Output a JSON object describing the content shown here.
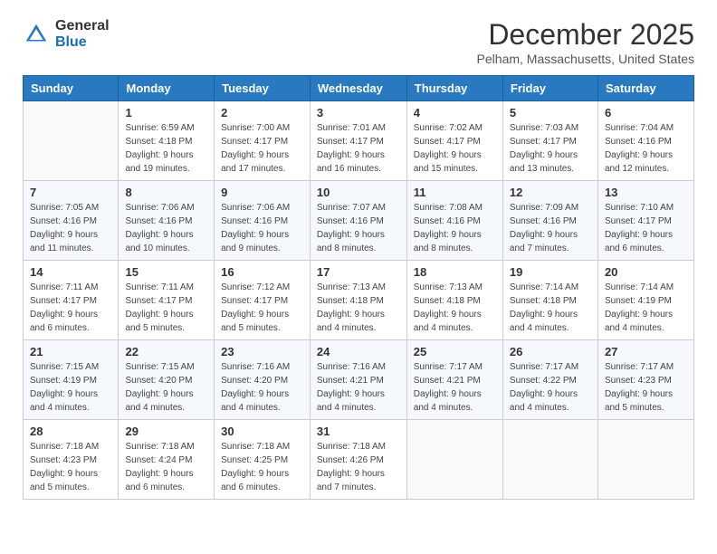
{
  "logo": {
    "general": "General",
    "blue": "Blue"
  },
  "title": "December 2025",
  "location": "Pelham, Massachusetts, United States",
  "days_of_week": [
    "Sunday",
    "Monday",
    "Tuesday",
    "Wednesday",
    "Thursday",
    "Friday",
    "Saturday"
  ],
  "weeks": [
    [
      {
        "day": "",
        "sunrise": "",
        "sunset": "",
        "daylight": ""
      },
      {
        "day": "1",
        "sunrise": "Sunrise: 6:59 AM",
        "sunset": "Sunset: 4:18 PM",
        "daylight": "Daylight: 9 hours and 19 minutes."
      },
      {
        "day": "2",
        "sunrise": "Sunrise: 7:00 AM",
        "sunset": "Sunset: 4:17 PM",
        "daylight": "Daylight: 9 hours and 17 minutes."
      },
      {
        "day": "3",
        "sunrise": "Sunrise: 7:01 AM",
        "sunset": "Sunset: 4:17 PM",
        "daylight": "Daylight: 9 hours and 16 minutes."
      },
      {
        "day": "4",
        "sunrise": "Sunrise: 7:02 AM",
        "sunset": "Sunset: 4:17 PM",
        "daylight": "Daylight: 9 hours and 15 minutes."
      },
      {
        "day": "5",
        "sunrise": "Sunrise: 7:03 AM",
        "sunset": "Sunset: 4:17 PM",
        "daylight": "Daylight: 9 hours and 13 minutes."
      },
      {
        "day": "6",
        "sunrise": "Sunrise: 7:04 AM",
        "sunset": "Sunset: 4:16 PM",
        "daylight": "Daylight: 9 hours and 12 minutes."
      }
    ],
    [
      {
        "day": "7",
        "sunrise": "Sunrise: 7:05 AM",
        "sunset": "Sunset: 4:16 PM",
        "daylight": "Daylight: 9 hours and 11 minutes."
      },
      {
        "day": "8",
        "sunrise": "Sunrise: 7:06 AM",
        "sunset": "Sunset: 4:16 PM",
        "daylight": "Daylight: 9 hours and 10 minutes."
      },
      {
        "day": "9",
        "sunrise": "Sunrise: 7:06 AM",
        "sunset": "Sunset: 4:16 PM",
        "daylight": "Daylight: 9 hours and 9 minutes."
      },
      {
        "day": "10",
        "sunrise": "Sunrise: 7:07 AM",
        "sunset": "Sunset: 4:16 PM",
        "daylight": "Daylight: 9 hours and 8 minutes."
      },
      {
        "day": "11",
        "sunrise": "Sunrise: 7:08 AM",
        "sunset": "Sunset: 4:16 PM",
        "daylight": "Daylight: 9 hours and 8 minutes."
      },
      {
        "day": "12",
        "sunrise": "Sunrise: 7:09 AM",
        "sunset": "Sunset: 4:16 PM",
        "daylight": "Daylight: 9 hours and 7 minutes."
      },
      {
        "day": "13",
        "sunrise": "Sunrise: 7:10 AM",
        "sunset": "Sunset: 4:17 PM",
        "daylight": "Daylight: 9 hours and 6 minutes."
      }
    ],
    [
      {
        "day": "14",
        "sunrise": "Sunrise: 7:11 AM",
        "sunset": "Sunset: 4:17 PM",
        "daylight": "Daylight: 9 hours and 6 minutes."
      },
      {
        "day": "15",
        "sunrise": "Sunrise: 7:11 AM",
        "sunset": "Sunset: 4:17 PM",
        "daylight": "Daylight: 9 hours and 5 minutes."
      },
      {
        "day": "16",
        "sunrise": "Sunrise: 7:12 AM",
        "sunset": "Sunset: 4:17 PM",
        "daylight": "Daylight: 9 hours and 5 minutes."
      },
      {
        "day": "17",
        "sunrise": "Sunrise: 7:13 AM",
        "sunset": "Sunset: 4:18 PM",
        "daylight": "Daylight: 9 hours and 4 minutes."
      },
      {
        "day": "18",
        "sunrise": "Sunrise: 7:13 AM",
        "sunset": "Sunset: 4:18 PM",
        "daylight": "Daylight: 9 hours and 4 minutes."
      },
      {
        "day": "19",
        "sunrise": "Sunrise: 7:14 AM",
        "sunset": "Sunset: 4:18 PM",
        "daylight": "Daylight: 9 hours and 4 minutes."
      },
      {
        "day": "20",
        "sunrise": "Sunrise: 7:14 AM",
        "sunset": "Sunset: 4:19 PM",
        "daylight": "Daylight: 9 hours and 4 minutes."
      }
    ],
    [
      {
        "day": "21",
        "sunrise": "Sunrise: 7:15 AM",
        "sunset": "Sunset: 4:19 PM",
        "daylight": "Daylight: 9 hours and 4 minutes."
      },
      {
        "day": "22",
        "sunrise": "Sunrise: 7:15 AM",
        "sunset": "Sunset: 4:20 PM",
        "daylight": "Daylight: 9 hours and 4 minutes."
      },
      {
        "day": "23",
        "sunrise": "Sunrise: 7:16 AM",
        "sunset": "Sunset: 4:20 PM",
        "daylight": "Daylight: 9 hours and 4 minutes."
      },
      {
        "day": "24",
        "sunrise": "Sunrise: 7:16 AM",
        "sunset": "Sunset: 4:21 PM",
        "daylight": "Daylight: 9 hours and 4 minutes."
      },
      {
        "day": "25",
        "sunrise": "Sunrise: 7:17 AM",
        "sunset": "Sunset: 4:21 PM",
        "daylight": "Daylight: 9 hours and 4 minutes."
      },
      {
        "day": "26",
        "sunrise": "Sunrise: 7:17 AM",
        "sunset": "Sunset: 4:22 PM",
        "daylight": "Daylight: 9 hours and 4 minutes."
      },
      {
        "day": "27",
        "sunrise": "Sunrise: 7:17 AM",
        "sunset": "Sunset: 4:23 PM",
        "daylight": "Daylight: 9 hours and 5 minutes."
      }
    ],
    [
      {
        "day": "28",
        "sunrise": "Sunrise: 7:18 AM",
        "sunset": "Sunset: 4:23 PM",
        "daylight": "Daylight: 9 hours and 5 minutes."
      },
      {
        "day": "29",
        "sunrise": "Sunrise: 7:18 AM",
        "sunset": "Sunset: 4:24 PM",
        "daylight": "Daylight: 9 hours and 6 minutes."
      },
      {
        "day": "30",
        "sunrise": "Sunrise: 7:18 AM",
        "sunset": "Sunset: 4:25 PM",
        "daylight": "Daylight: 9 hours and 6 minutes."
      },
      {
        "day": "31",
        "sunrise": "Sunrise: 7:18 AM",
        "sunset": "Sunset: 4:26 PM",
        "daylight": "Daylight: 9 hours and 7 minutes."
      },
      {
        "day": "",
        "sunrise": "",
        "sunset": "",
        "daylight": ""
      },
      {
        "day": "",
        "sunrise": "",
        "sunset": "",
        "daylight": ""
      },
      {
        "day": "",
        "sunrise": "",
        "sunset": "",
        "daylight": ""
      }
    ]
  ]
}
